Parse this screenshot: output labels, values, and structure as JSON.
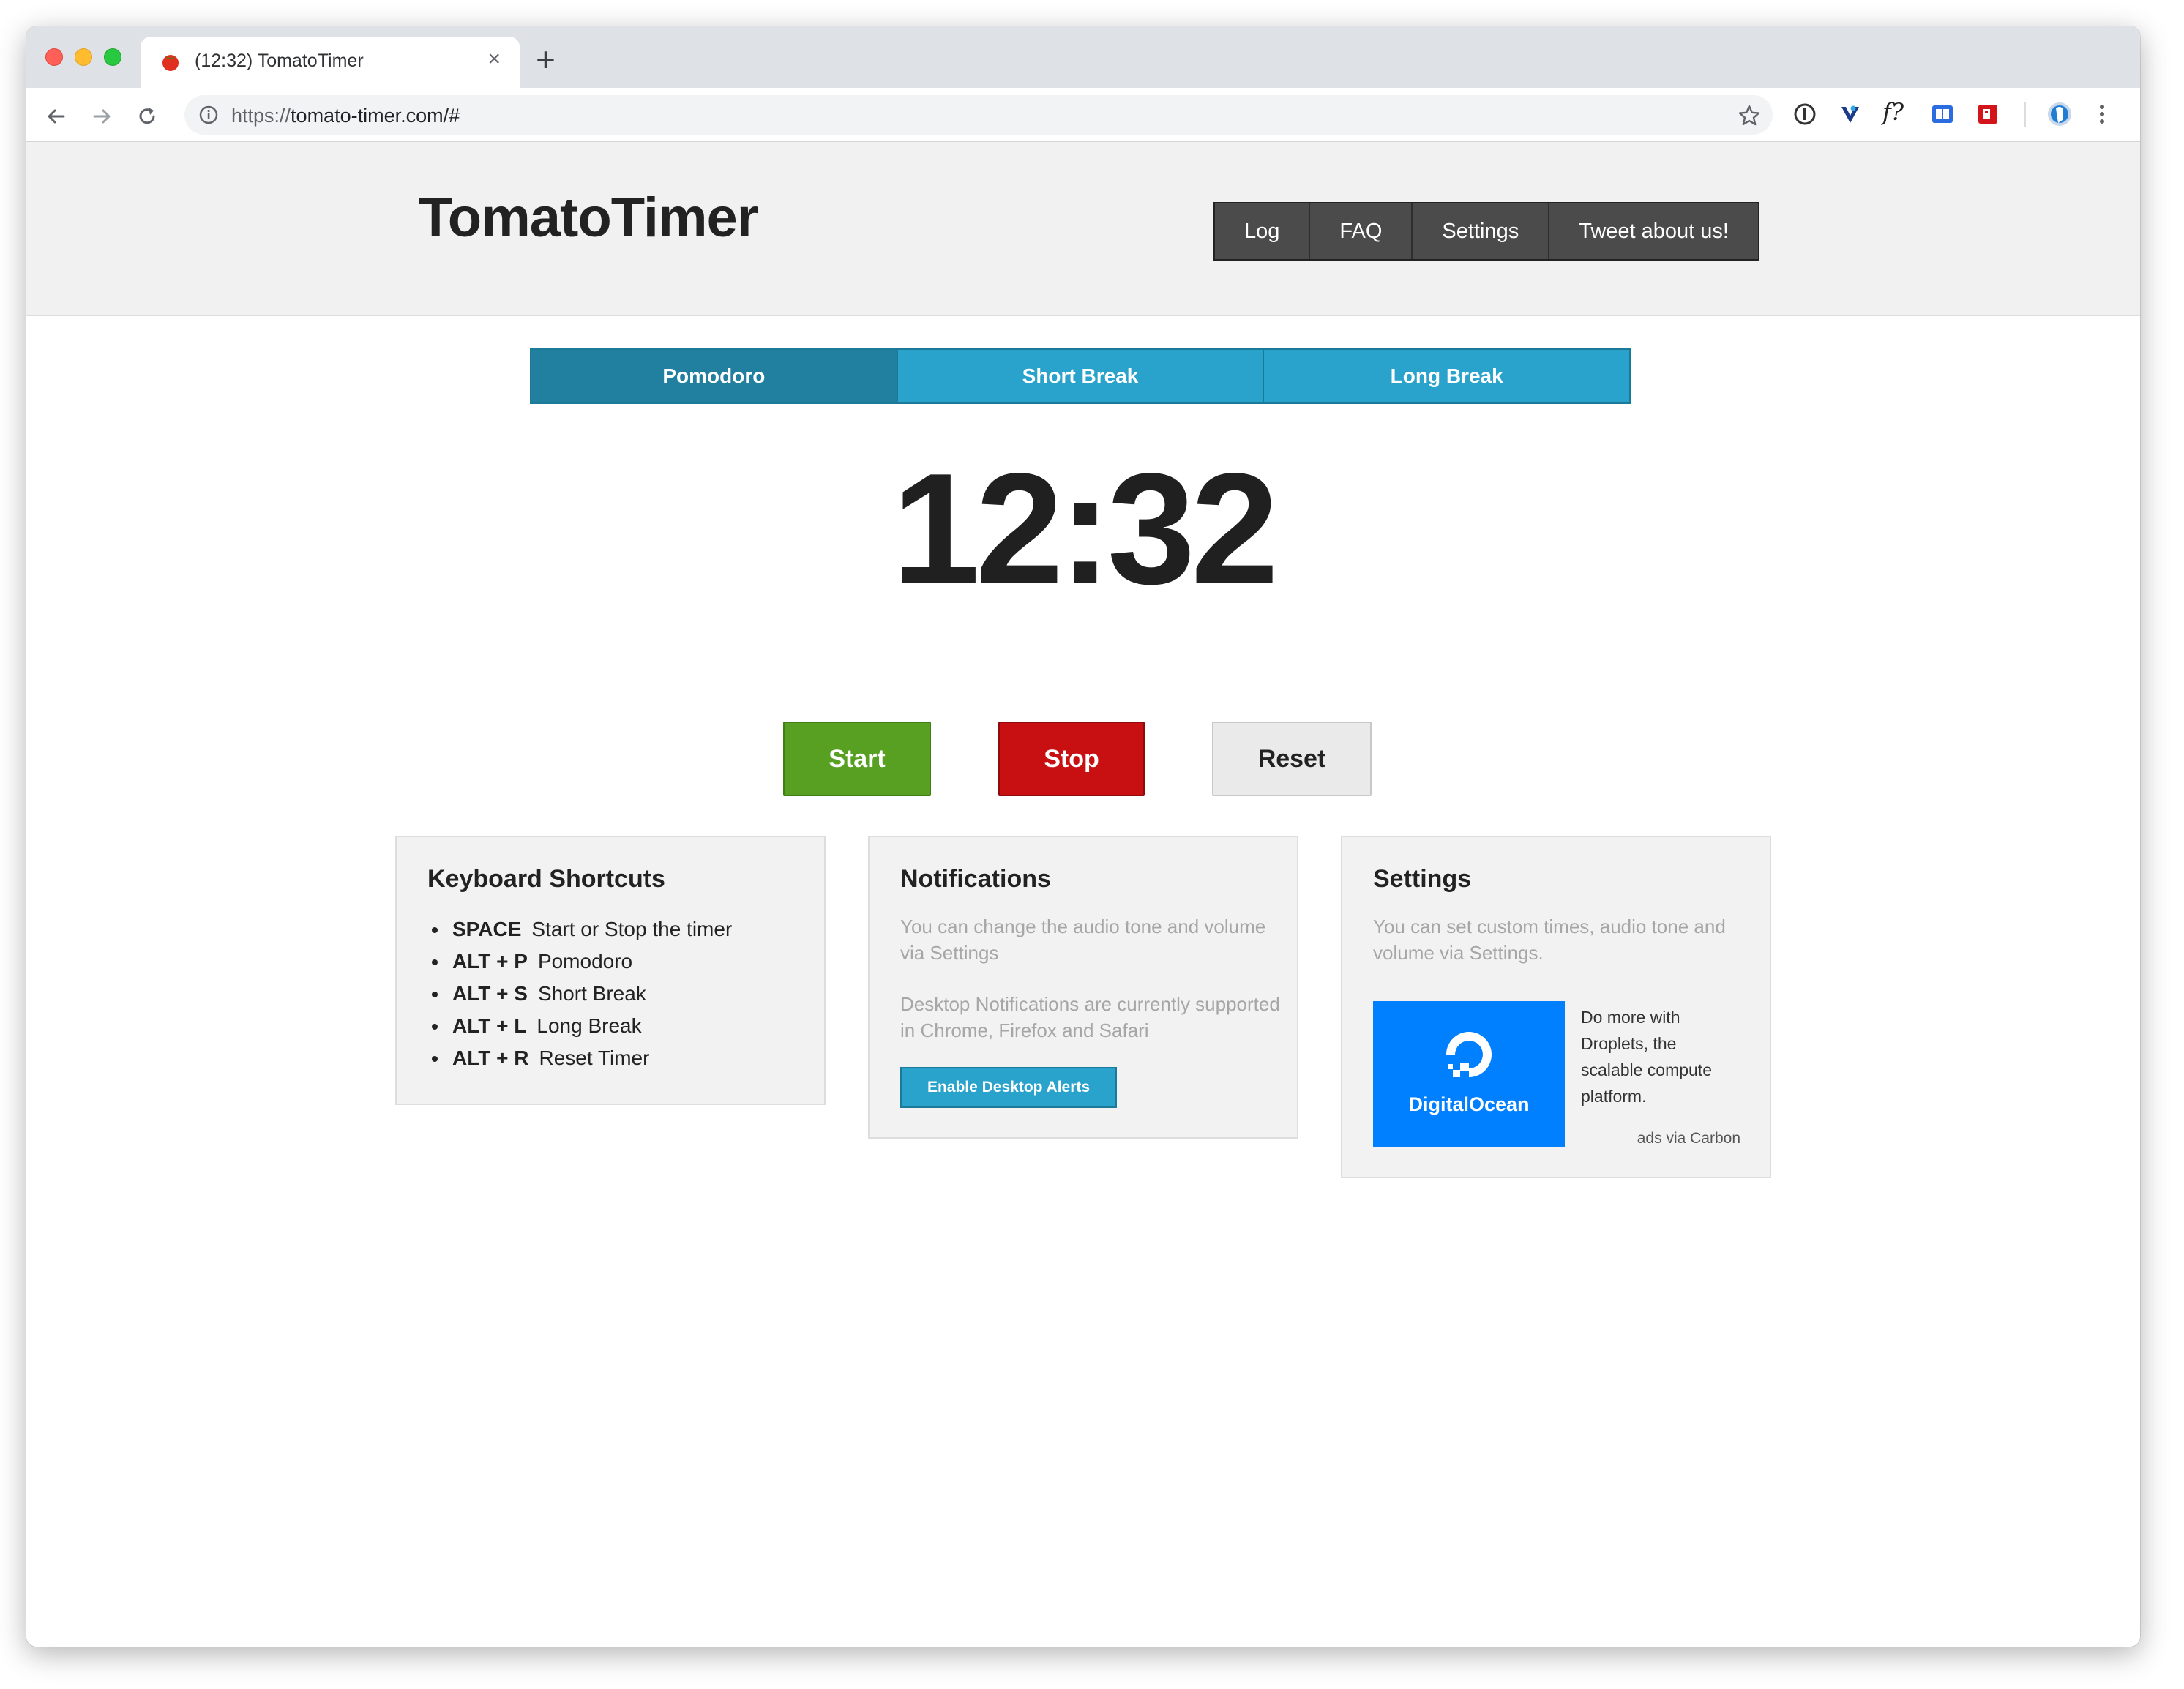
{
  "browser": {
    "tab_title": "(12:32) TomatoTimer",
    "tab_close": "×",
    "new_tab": "+",
    "url_scheme": "https://",
    "url_rest": "tomato-timer.com/#",
    "extensions": [
      "password-manager-icon",
      "vivaldi-extension-icon",
      "font-finder-icon",
      "reader-extension-icon",
      "pdf-extension-icon",
      "profile-avatar-icon",
      "more-menu-icon"
    ],
    "ext_labels": {
      "font": "f?"
    }
  },
  "header": {
    "brand": "TomatoTimer",
    "nav": [
      "Log",
      "FAQ",
      "Settings",
      "Tweet about us!"
    ]
  },
  "modes": {
    "pomodoro": "Pomodoro",
    "short_break": "Short Break",
    "long_break": "Long Break",
    "active": "Pomodoro"
  },
  "timer": {
    "display": "12:32"
  },
  "controls": {
    "start": "Start",
    "stop": "Stop",
    "reset": "Reset"
  },
  "colors": {
    "mode_bar": "#29a3cc",
    "mode_active": "#217f9f",
    "start": "#58a021",
    "stop": "#c80f12",
    "reset": "#eaeaea",
    "ad_background": "#0080ff"
  },
  "shortcuts": {
    "title": "Keyboard Shortcuts",
    "items": [
      {
        "key": "SPACE",
        "action": "Start or Stop the timer"
      },
      {
        "key": "ALT + P",
        "action": "Pomodoro"
      },
      {
        "key": "ALT + S",
        "action": "Short Break"
      },
      {
        "key": "ALT + L",
        "action": "Long Break"
      },
      {
        "key": "ALT + R",
        "action": "Reset Timer"
      }
    ]
  },
  "notifications": {
    "title": "Notifications",
    "text1": "You can change the audio tone and volume via Settings",
    "text2": "Desktop Notifications are currently supported in Chrome, Firefox and Safari",
    "button": "Enable Desktop Alerts"
  },
  "settings": {
    "title": "Settings",
    "text": "You can set custom times, audio tone and volume via Settings.",
    "ad_brand": "DigitalOcean",
    "ad_text": "Do more with Droplets, the scalable compute platform.",
    "ad_via": "ads via Carbon"
  }
}
